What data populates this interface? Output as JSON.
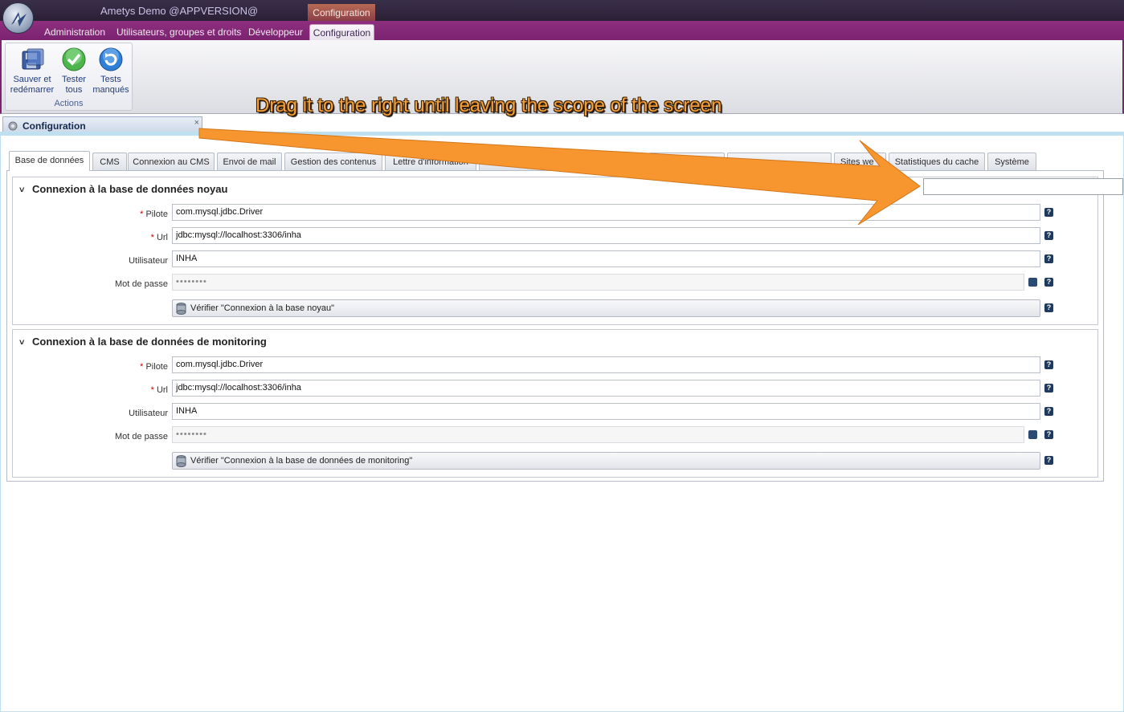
{
  "app": {
    "title": "Ametys Demo @APPVERSION@",
    "context_tab_header": "Configuration"
  },
  "ribbon_tabs": [
    {
      "label": "Administration"
    },
    {
      "label": "Utilisateurs, groupes et droits"
    },
    {
      "label": "Développeur"
    },
    {
      "label": "Configuration"
    }
  ],
  "ribbon": {
    "buttons": [
      {
        "label_line1": "Sauver et",
        "label_line2": "redémarrer",
        "icon": "save-restart-icon"
      },
      {
        "label_line1": "Tester",
        "label_line2": "tous",
        "icon": "check-icon"
      },
      {
        "label_line1": "Tests",
        "label_line2": "manqués",
        "icon": "refresh-icon"
      }
    ],
    "group_label": "Actions"
  },
  "panel": {
    "title": "Configuration",
    "close": "×"
  },
  "inner_tabs": [
    {
      "label": "Base de données"
    },
    {
      "label": "CMS"
    },
    {
      "label": "Connexion au CMS"
    },
    {
      "label": "Envoi de mail"
    },
    {
      "label": "Gestion des contenus"
    },
    {
      "label": "Lettre d'information"
    },
    {
      "label": "Recherche"
    },
    {
      "label": ""
    },
    {
      "label": ""
    },
    {
      "label": "Sites we"
    },
    {
      "label": "Statistiques du cache"
    },
    {
      "label": "Système"
    }
  ],
  "sections": [
    {
      "title": "Connexion à la base de données noyau",
      "pilote_label": "Pilote",
      "pilote_value": "com.mysql.jdbc.Driver",
      "url_label": "Url",
      "url_value": "jdbc:mysql://localhost:3306/inha",
      "user_label": "Utilisateur",
      "user_value": "INHA",
      "pwd_label": "Mot de passe",
      "pwd_value": "••••••••",
      "verify_label": "Vérifier \"Connexion à la base noyau\""
    },
    {
      "title": "Connexion à la base de données de monitoring",
      "pilote_label": "Pilote",
      "pilote_value": "com.mysql.jdbc.Driver",
      "url_label": "Url",
      "url_value": "jdbc:mysql://localhost:3306/inha",
      "user_label": "Utilisateur",
      "user_value": "INHA",
      "pwd_label": "Mot de passe",
      "pwd_value": "••••••••",
      "verify_label": "Vérifier \"Connexion à la base de données de monitoring\""
    }
  ],
  "required_mark": "*",
  "help_glyph": "?",
  "annotation": {
    "text": "Drag it to the right until leaving the scope of the screen",
    "color": "#f6a039"
  }
}
